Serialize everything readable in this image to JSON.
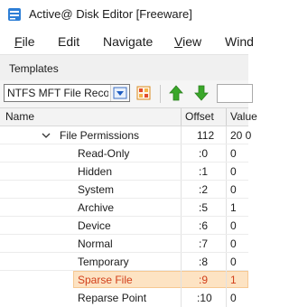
{
  "window": {
    "title": "Active@ Disk Editor [Freeware]",
    "app_icon": "disk-editor-icon"
  },
  "menu": [
    {
      "label": "File",
      "underline": "F",
      "rest": "ile"
    },
    {
      "label": "Edit",
      "underline": "",
      "rest": "Edit"
    },
    {
      "label": "Navigate",
      "underline": "",
      "rest": "Navigate"
    },
    {
      "label": "View",
      "underline": "V",
      "rest": "iew"
    },
    {
      "label": "Window",
      "underline": "",
      "rest": "Wind"
    }
  ],
  "templates_panel": {
    "title": "Templates"
  },
  "toolbar": {
    "template_select": "NTFS MFT File Recor",
    "icons": [
      "dropdown-arrow-icon",
      "template-grid-icon",
      "up-arrow-icon",
      "down-arrow-icon"
    ]
  },
  "grid": {
    "columns": [
      "Name",
      "Offset",
      "Value"
    ],
    "group": {
      "name": "File Permissions",
      "offset": "112",
      "value": "20 0"
    },
    "rows": [
      {
        "name": "Read-Only",
        "offset": ":0",
        "value": "0"
      },
      {
        "name": "Hidden",
        "offset": ":1",
        "value": "0"
      },
      {
        "name": "System",
        "offset": ":2",
        "value": "0"
      },
      {
        "name": "Archive",
        "offset": ":5",
        "value": "1"
      },
      {
        "name": "Device",
        "offset": ":6",
        "value": "0"
      },
      {
        "name": "Normal",
        "offset": ":7",
        "value": "0"
      },
      {
        "name": "Temporary",
        "offset": ":8",
        "value": "0"
      },
      {
        "name": "Sparse File",
        "offset": ":9",
        "value": "1",
        "selected": true
      },
      {
        "name": "Reparse Point",
        "offset": ":10",
        "value": "0"
      }
    ]
  },
  "colors": {
    "selected_text": "#d1401c",
    "selected_bg": "#fde3c3",
    "arrow_up": "#3aa72a",
    "arrow_down": "#3aa72a"
  }
}
